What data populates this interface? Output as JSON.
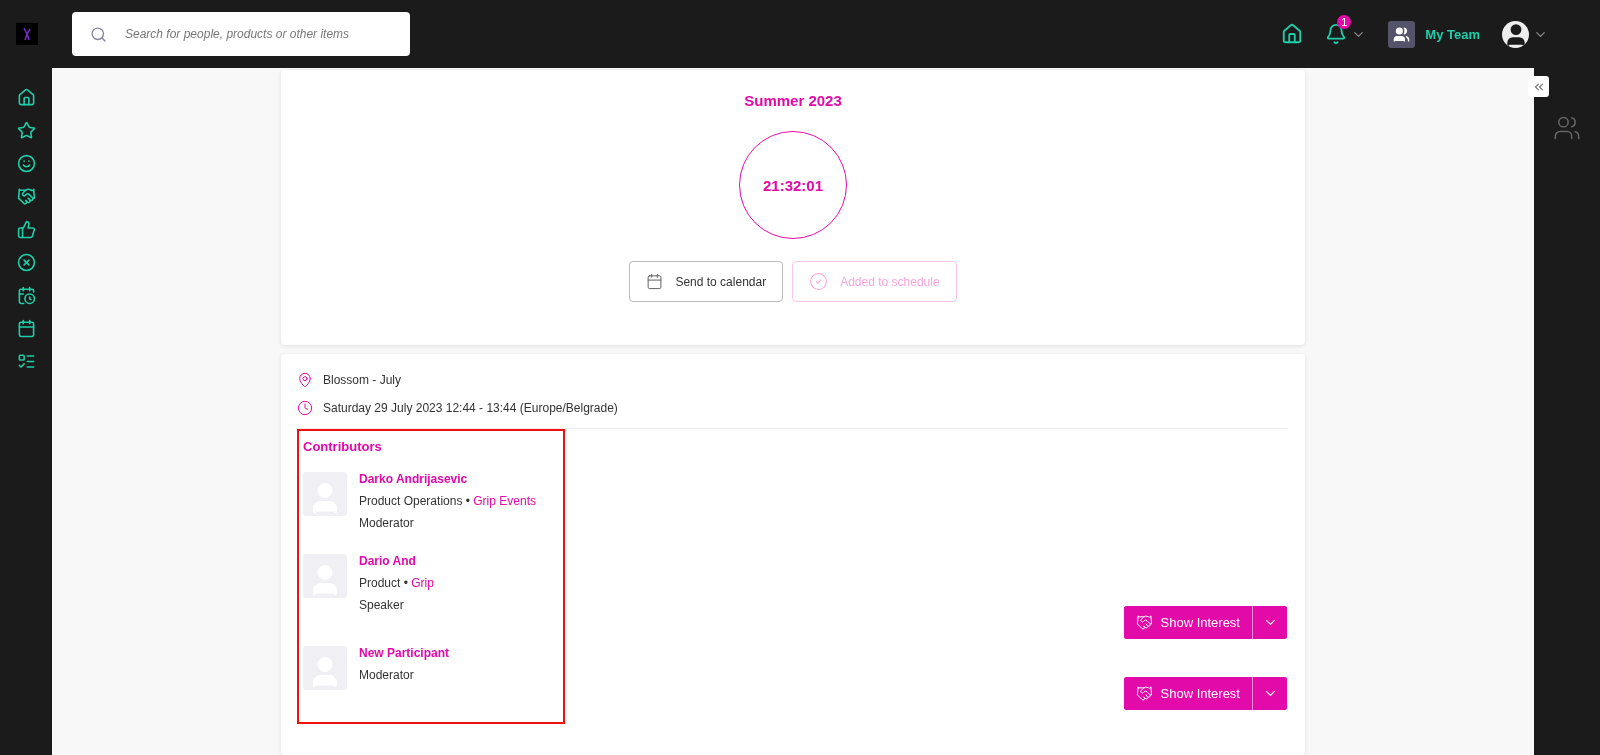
{
  "search": {
    "placeholder": "Search for people, products or other items"
  },
  "header": {
    "notifications": "1",
    "team": "My Team"
  },
  "session": {
    "title": "Summer 2023",
    "countdown": "21:32:01",
    "buttons": [
      {
        "label": "Send to calendar",
        "kind": "calendar",
        "disabled": false
      },
      {
        "label": "Added to schedule",
        "kind": "added",
        "disabled": true
      }
    ],
    "location": "Blossom - July",
    "time": "Saturday 29 July 2023 12:44 - 13:44 (Europe/Belgrade)"
  },
  "contributors": {
    "title": "Contributors",
    "items": [
      {
        "name": "Darko Andrijasevic",
        "job": "Product Operations",
        "separator": "•",
        "company": "Grip Events",
        "role": "Moderator"
      },
      {
        "name": "Dario And",
        "job": "Product",
        "separator": "•",
        "company": "Grip",
        "role": "Speaker",
        "action": "Show Interest"
      },
      {
        "name": "New Participant",
        "role": "Moderator",
        "action": "Show Interest"
      }
    ]
  }
}
